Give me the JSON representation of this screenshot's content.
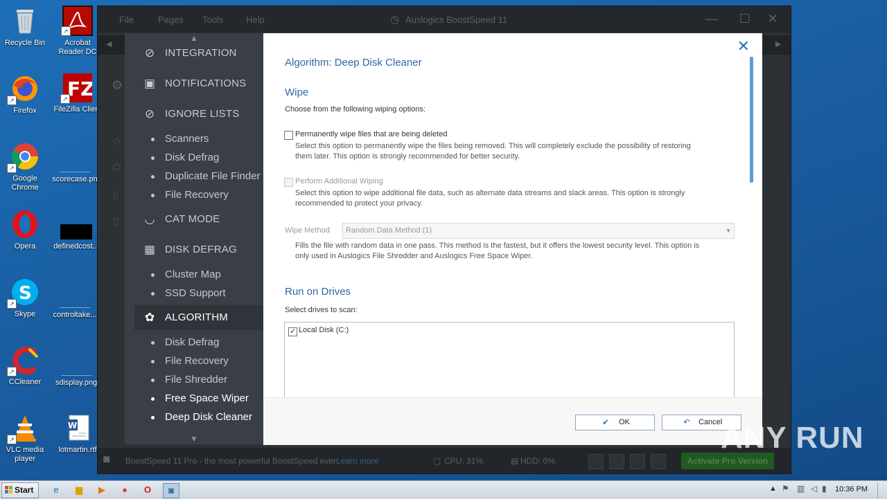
{
  "desktop": {
    "icons": [
      {
        "label": "Recycle Bin",
        "icon": "recycle-bin-icon"
      },
      {
        "label": "Acrobat Reader DC",
        "icon": "acrobat-icon"
      },
      {
        "label": "Firefox",
        "icon": "firefox-icon"
      },
      {
        "label": "FileZilla Client",
        "icon": "filezilla-icon"
      },
      {
        "label": "Google Chrome",
        "icon": "chrome-icon"
      },
      {
        "label": "scorecase.pn",
        "icon": "file-icon"
      },
      {
        "label": "Opera",
        "icon": "opera-icon"
      },
      {
        "label": "definedcost...",
        "icon": "file-icon"
      },
      {
        "label": "Skype",
        "icon": "skype-icon"
      },
      {
        "label": "controltake...",
        "icon": "file-icon"
      },
      {
        "label": "CCleaner",
        "icon": "ccleaner-icon"
      },
      {
        "label": "sdisplay.png",
        "icon": "file-icon"
      },
      {
        "label": "VLC media player",
        "icon": "vlc-icon"
      },
      {
        "label": "lotmartin.rtf",
        "icon": "word-doc-icon"
      }
    ]
  },
  "app": {
    "menu": [
      "File",
      "Pages",
      "Tools",
      "Help"
    ],
    "title": "Auslogics BoostSpeed 11",
    "status": {
      "promo": "BoostSpeed 11 Pro - the most powerful BoostSpeed ever!",
      "learn_more": "Learn more",
      "cpu": "CPU: 31%",
      "hdd": "HDD: 0%",
      "activate": "Activate Pro Version"
    }
  },
  "sidebar": {
    "integration": "INTEGRATION",
    "notifications": "NOTIFICATIONS",
    "ignore_lists": "IGNORE LISTS",
    "ignore_subs": [
      "Scanners",
      "Disk Defrag",
      "Duplicate File Finder",
      "File Recovery"
    ],
    "cat_mode": "CAT MODE",
    "disk_defrag": "DISK DEFRAG",
    "defrag_subs": [
      "Cluster Map",
      "SSD Support"
    ],
    "algorithm": "ALGORITHM",
    "algorithm_subs": [
      "Disk Defrag",
      "File Recovery",
      "File Shredder",
      "Free Space Wiper",
      "Deep Disk Cleaner"
    ]
  },
  "dialog": {
    "heading": "Algorithm: Deep Disk Cleaner",
    "wipe_title": "Wipe",
    "wipe_intro": "Choose from the following wiping options:",
    "opt1_label": "Permanently wipe files that are being deleted",
    "opt1_desc1": "Select this option to permanently wipe the files being removed. This will completely exclude the possibility of restoring",
    "opt1_desc2": "them later. This option is strongly recommended for better security.",
    "opt2_label": "Perform Additional Wiping",
    "opt2_desc1": "Select this option to wipe additional file data, such as alternate data streams and slack areas. This option is strongly",
    "opt2_desc2": "recommended to protect your privacy.",
    "method_label": "Wipe Method",
    "method_value": "Random Data Method (1)",
    "method_desc1": "Fills the file with random data in one pass. This method is the fastest, but it offers the lowest security level. This option is",
    "method_desc2": "only used in Auslogics File Shredder and Auslogics Free Space Wiper.",
    "drives_title": "Run on Drives",
    "drives_intro": "Select drives to scan:",
    "drive1": "Local Disk (C:)",
    "ok": "OK",
    "cancel": "Cancel"
  },
  "taskbar": {
    "start": "Start",
    "clock": "10:36 PM"
  },
  "watermark": "ANY RUN"
}
